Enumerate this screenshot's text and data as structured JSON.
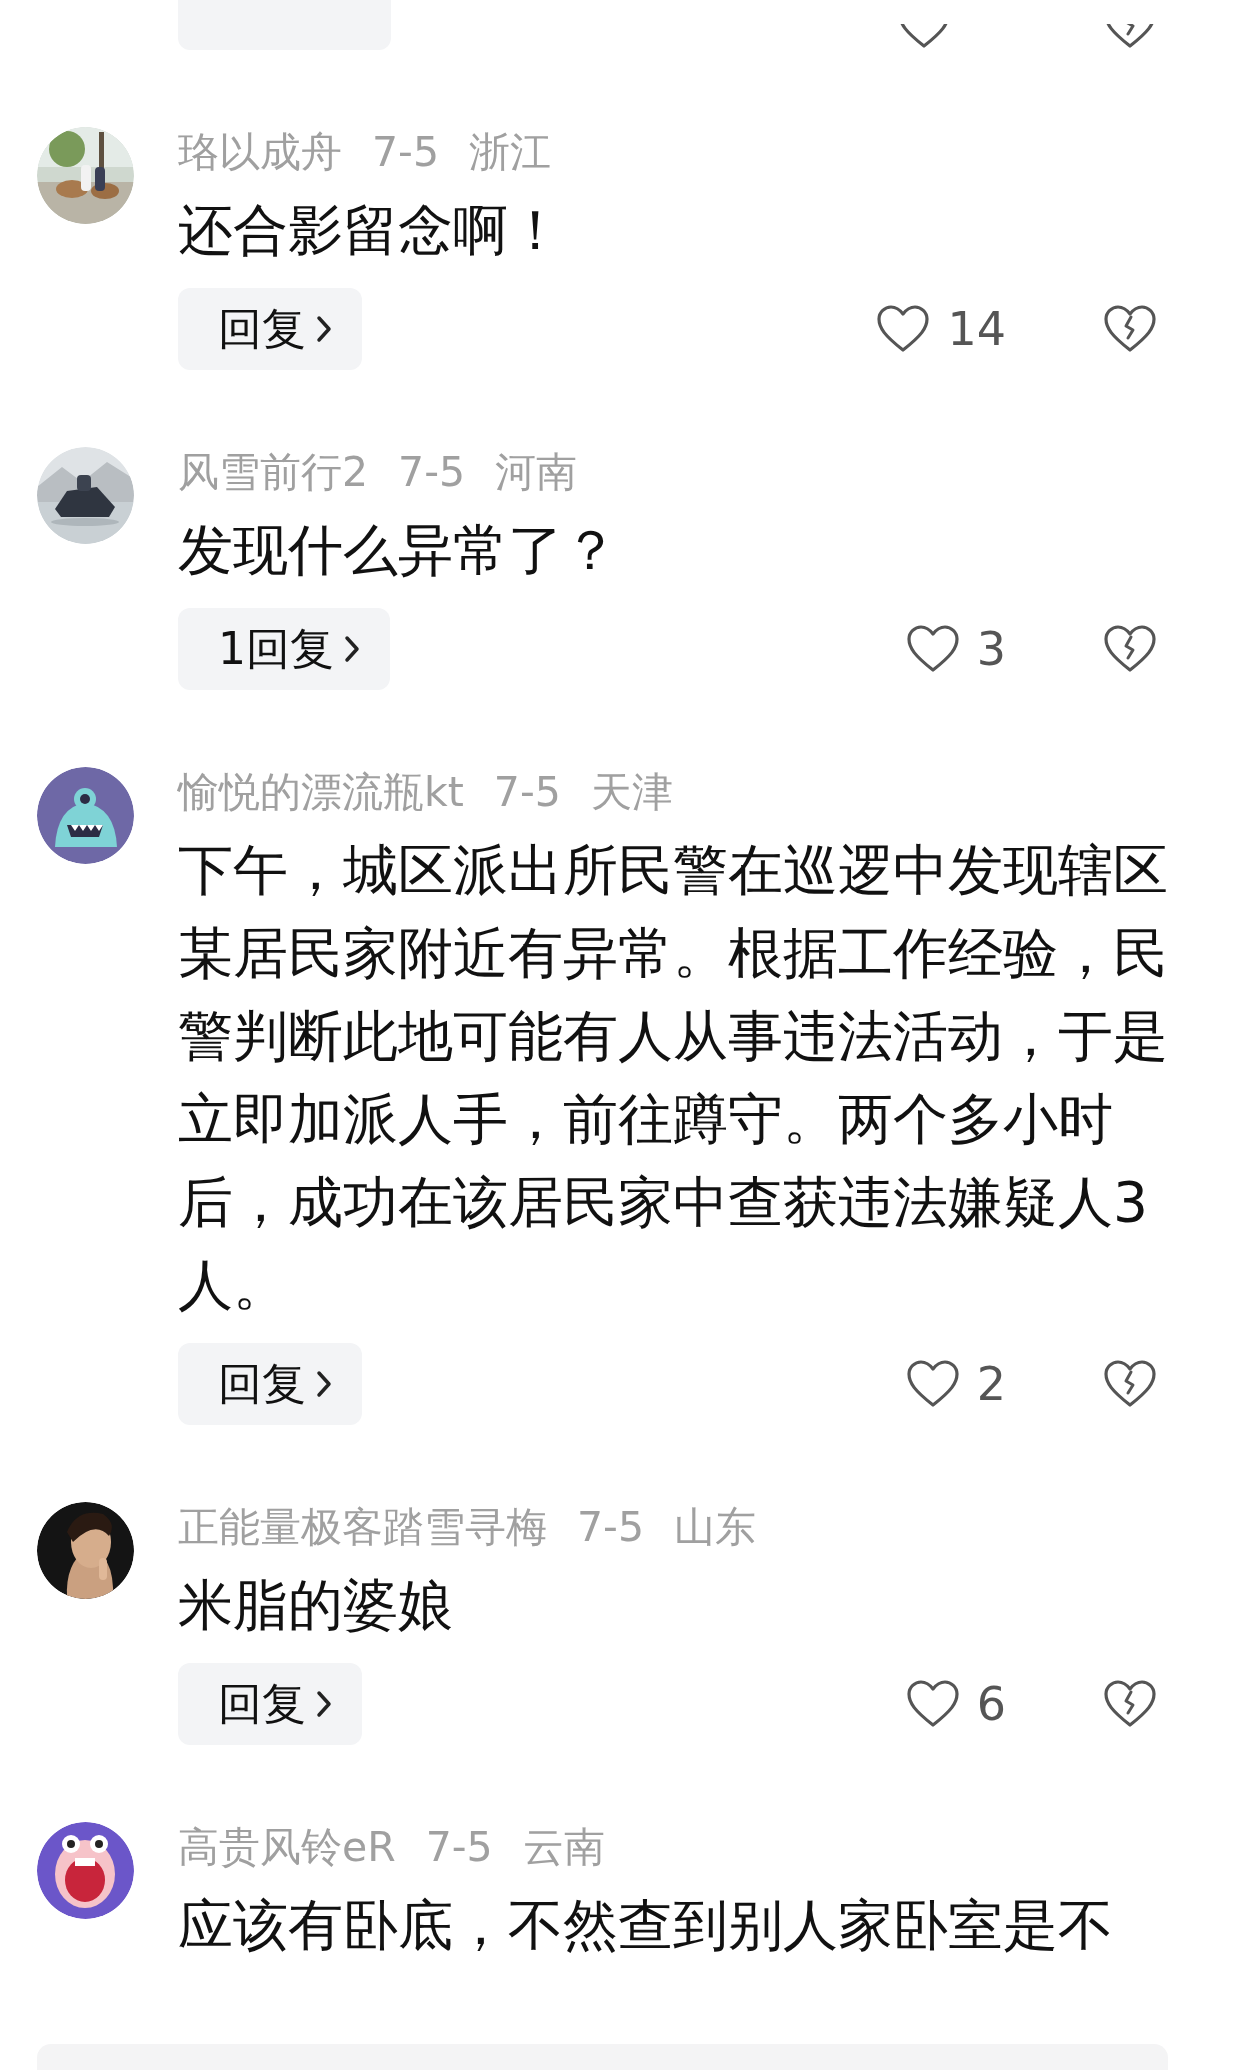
{
  "comments": [
    {
      "avatar": {
        "kind": "photo-park"
      },
      "user": "珞以成舟",
      "date": "7-5",
      "region": "浙江",
      "text": "还合影留念啊！",
      "reply": "回复",
      "likes": "14"
    },
    {
      "avatar": {
        "kind": "photo-water"
      },
      "user": "风雪前行2",
      "date": "7-5",
      "region": "河南",
      "text": "发现什么异常了？",
      "reply": "1回复",
      "likes": "3"
    },
    {
      "avatar": {
        "kind": "cartoon-monster"
      },
      "user": "愉悦的漂流瓶kt",
      "date": "7-5",
      "region": "天津",
      "text": "下午，城区派出所民警在巡逻中发现辖区某居民家附近有异常。根据工作经验，民警判断此地可能有人从事违法活动，于是立即加派人手，前往蹲守。两个多小时后，成功在该居民家中查获违法嫌疑人3人。",
      "reply": "回复",
      "likes": "2"
    },
    {
      "avatar": {
        "kind": "photo-portrait"
      },
      "user": "正能量极客踏雪寻梅",
      "date": "7-5",
      "region": "山东",
      "text": "米脂的婆娘",
      "reply": "回复",
      "likes": "6"
    },
    {
      "avatar": {
        "kind": "cartoon-mouth"
      },
      "user": "高贵风铃eR",
      "date": "7-5",
      "region": "云南",
      "text": "应该有卧底，不然查到别人家卧室是不"
    }
  ]
}
